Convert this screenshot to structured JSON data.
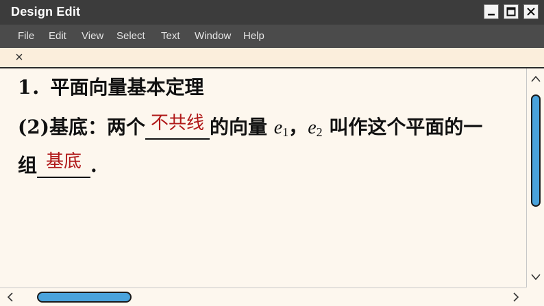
{
  "window": {
    "title": "Design Edit",
    "minimize_icon": "minimize-icon",
    "maximize_icon": "maximize-icon",
    "close_icon": "close-icon"
  },
  "menu": {
    "items": [
      "File",
      "Edit",
      "View",
      "Select",
      "Text",
      "Window",
      "Help"
    ]
  },
  "tab": {
    "close_label": "×"
  },
  "document": {
    "heading": "1．平面向量基本定理",
    "line1": {
      "prefix": "(2)基底：两个",
      "blank1_answer": "不共线",
      "middle": "的向量 ",
      "e1_base": "e",
      "e1_sub": "1",
      "comma": "，",
      "e2_base": "e",
      "e2_sub": "2",
      "suffix": " 叫作这个平面的一"
    },
    "line2": {
      "prefix": "组",
      "blank2_answer": "基底",
      "suffix": "."
    }
  },
  "colors": {
    "titlebar": "#3c3c3c",
    "menubar": "#4b4b4b",
    "tabbar": "#fbeedc",
    "content_bg": "#fdf7ee",
    "answer_text": "#b01818",
    "scroll_thumb": "#4aa3dc"
  }
}
